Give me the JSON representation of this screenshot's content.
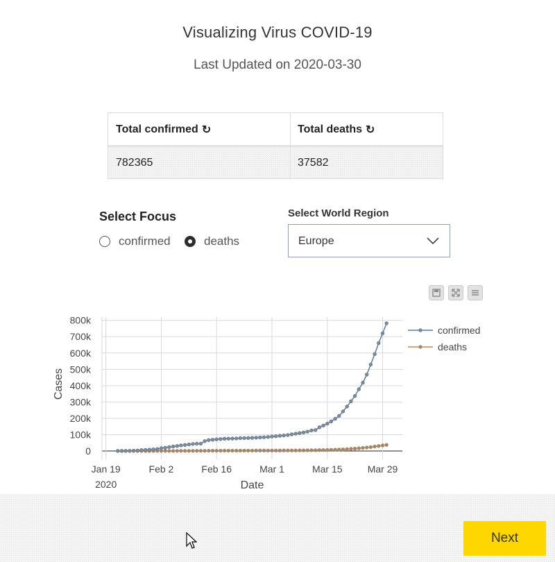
{
  "header": {
    "title": "Visualizing Virus COVID-19",
    "subtitle": "Last Updated on 2020-03-30"
  },
  "stats": {
    "confirmed_label": "Total confirmed",
    "deaths_label": "Total deaths",
    "refresh_icon": "refresh-icon",
    "confirmed_value": "782365",
    "deaths_value": "37582"
  },
  "focus": {
    "title": "Select Focus",
    "options": [
      "confirmed",
      "deaths"
    ],
    "selected": "deaths"
  },
  "region": {
    "label": "Select World Region",
    "value": "Europe"
  },
  "modebar": {
    "icons": [
      "download-icon",
      "autoscale-icon",
      "menu-icon"
    ]
  },
  "chart_data": {
    "type": "line",
    "xlabel": "Date",
    "ylabel": "Cases",
    "x_start": "2020-01-22",
    "x_end": "2020-03-30",
    "x_ticks": [
      "Jan 19",
      "Feb 2",
      "Feb 16",
      "Mar 1",
      "Mar 15",
      "Mar 29"
    ],
    "x_year_label": "2020",
    "y_ticks": [
      "0",
      "100k",
      "200k",
      "300k",
      "400k",
      "500k",
      "600k",
      "700k",
      "800k"
    ],
    "ylim": [
      0,
      820000
    ],
    "legend_position": "right",
    "grid": true,
    "series": [
      {
        "name": "confirmed",
        "color": "#5a7aa0",
        "values": [
          555,
          654,
          941,
          1434,
          2118,
          2927,
          5578,
          6166,
          8234,
          9927,
          12038,
          16787,
          19881,
          23892,
          27635,
          30794,
          34391,
          37120,
          40150,
          42762,
          44802,
          45221,
          60368,
          66885,
          69030,
          71224,
          73258,
          75136,
          75639,
          76197,
          76819,
          78572,
          78958,
          79561,
          80406,
          81388,
          82746,
          84112,
          86011,
          88369,
          90306,
          92840,
          95120,
          97886,
          101801,
          105847,
          109821,
          113590,
          118620,
          125875,
          128352,
          145205,
          156101,
          167454,
          181574,
          197102,
          214821,
          242570,
          272208,
          304507,
          336953,
          378235,
          418045,
          467653,
          529591,
          593291,
          660706,
          720117,
          782365
        ]
      },
      {
        "name": "deaths",
        "color": "#c9874a",
        "values": [
          17,
          18,
          26,
          42,
          56,
          82,
          131,
          133,
          171,
          213,
          259,
          362,
          426,
          492,
          564,
          634,
          719,
          806,
          906,
          1013,
          1113,
          1118,
          1371,
          1523,
          1666,
          1770,
          1868,
          2007,
          2122,
          2247,
          2251,
          2458,
          2469,
          2629,
          2708,
          2770,
          2814,
          2872,
          2941,
          2996,
          3085,
          3160,
          3254,
          3348,
          3460,
          3558,
          3803,
          3996,
          4262,
          4615,
          4720,
          5404,
          5819,
          6440,
          7126,
          7905,
          8733,
          9867,
          11299,
          12973,
          14651,
          16505,
          18625,
          21181,
          23970,
          27198,
          30652,
          33925,
          37582
        ]
      }
    ]
  },
  "footer": {
    "next_label": "Next"
  }
}
